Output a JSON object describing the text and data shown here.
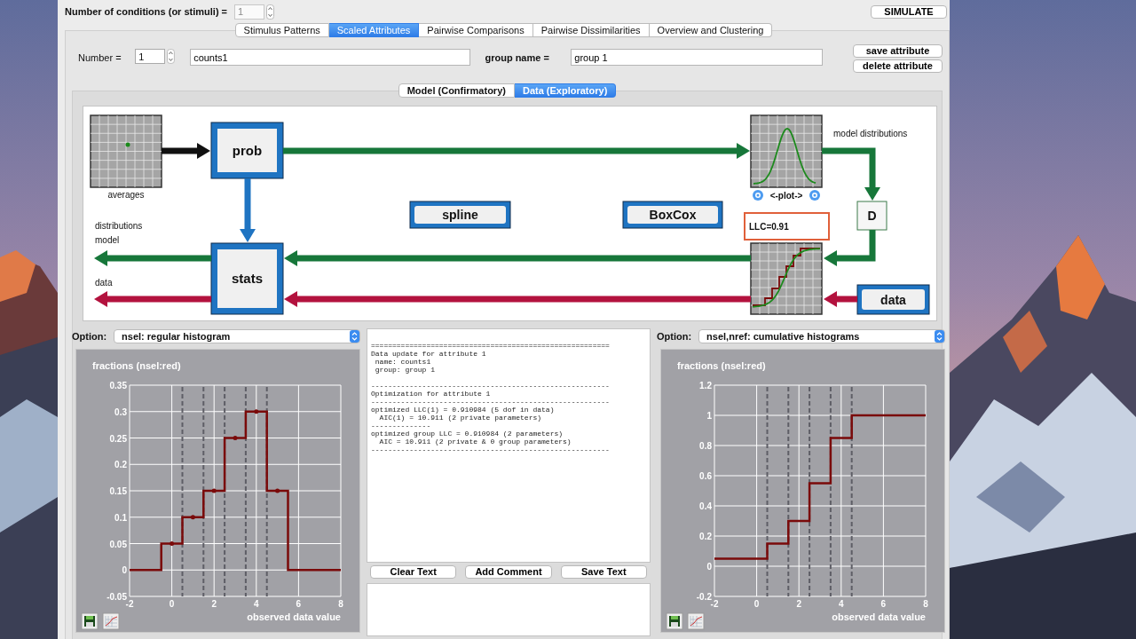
{
  "header": {
    "conditions_label": "Number of conditions (or stimuli) =",
    "conditions_value": "1",
    "simulate_button": "SIMULATE"
  },
  "tabs": [
    {
      "label": "Stimulus Patterns",
      "selected": false
    },
    {
      "label": "Scaled Attributes",
      "selected": true
    },
    {
      "label": "Pairwise Comparisons",
      "selected": false
    },
    {
      "label": "Pairwise Dissimilarities",
      "selected": false
    },
    {
      "label": "Overview and Clustering",
      "selected": false
    }
  ],
  "attribute": {
    "number_label": "Number =",
    "number_value": "1",
    "name_value": "counts1",
    "group_label": "group name =",
    "group_value": "group 1",
    "buttons": [
      "save attribute",
      "delete attribute"
    ]
  },
  "subtabs": [
    {
      "label": "Model (Confirmatory)",
      "selected": false
    },
    {
      "label": "Data (Exploratory)",
      "selected": true
    }
  ],
  "diagram": {
    "averages_label": "averages",
    "prob": "prob",
    "stats": "stats",
    "spline": "spline",
    "boxcox": "BoxCox",
    "plot_toggle": "<-plot->",
    "model_distributions": "model distributions",
    "d": "D",
    "llc": "LLC=0.91",
    "data_button": "data",
    "left_labels": [
      "distributions",
      "model",
      "data"
    ]
  },
  "left_panel": {
    "option_label": "Option:",
    "option_value": "nsel: regular histogram",
    "chart_data": {
      "type": "line",
      "title": "fractions (nsel:red)",
      "xlabel": "observed data value",
      "x": [
        -2,
        -0.5,
        -0.5,
        0,
        0.5,
        0.5,
        1,
        1.5,
        1.5,
        2,
        2.5,
        2.5,
        3,
        3.5,
        3.5,
        4,
        4.5,
        4.5,
        5,
        5.5,
        5.5,
        8
      ],
      "series": [
        {
          "color": "#7a0a0a",
          "values": [
            0,
            0,
            0.05,
            0.05,
            0.05,
            0.1,
            0.1,
            0.1,
            0.15,
            0.15,
            0.15,
            0.25,
            0.25,
            0.25,
            0.3,
            0.3,
            0.3,
            0.15,
            0.15,
            0.15,
            0,
            0
          ]
        }
      ],
      "xlim": [
        -2,
        8
      ],
      "ylim": [
        -0.05,
        0.35
      ],
      "xticks": [
        -2,
        0,
        2,
        4,
        6,
        8
      ],
      "yticks": [
        -0.05,
        0,
        0.05,
        0.1,
        0.15,
        0.2,
        0.25,
        0.3,
        0.35
      ],
      "grid": true,
      "ref_lines": [
        {
          "axis": "x",
          "value": 0.5
        },
        {
          "axis": "x",
          "value": 1.5
        },
        {
          "axis": "x",
          "value": 2.5
        },
        {
          "axis": "x",
          "value": 3.5
        },
        {
          "axis": "x",
          "value": 4.5
        }
      ]
    }
  },
  "log": {
    "text": "========================================================\nData update for attribute 1\n name: counts1\n group: group 1\n\n--------------------------------------------------------\nOptimization for attribute 1\n--------------------------------------------------------\noptimized LLC(1) = 0.910984 (5 dof in data)\n  AIC(1) = 10.911 (2 private parameters)\n--------------\noptimized group LLC = 0.910984 (2 parameters)\n  AIC = 10.911 (2 private & 0 group parameters)\n--------------------------------------------------------",
    "buttons": [
      "Clear Text",
      "Add Comment",
      "Save Text"
    ]
  },
  "right_panel": {
    "option_label": "Option:",
    "option_value": "nsel,nref: cumulative histograms",
    "chart_data": {
      "type": "line",
      "title": "fractions (nsel:red)",
      "xlabel": "observed data value",
      "x": [
        -2,
        0.5,
        0.5,
        1.5,
        1.5,
        2.5,
        2.5,
        3.5,
        3.5,
        4.5,
        4.5,
        8
      ],
      "series": [
        {
          "color": "#7a0a0a",
          "values": [
            0.05,
            0.05,
            0.15,
            0.15,
            0.3,
            0.3,
            0.55,
            0.55,
            0.85,
            0.85,
            1,
            1
          ]
        }
      ],
      "xlim": [
        -2,
        8
      ],
      "ylim": [
        -0.2,
        1.2
      ],
      "xticks": [
        -2,
        0,
        2,
        4,
        6,
        8
      ],
      "yticks": [
        -0.2,
        0,
        0.2,
        0.4,
        0.6,
        0.8,
        1,
        1.2
      ],
      "grid": true,
      "ref_lines": [
        {
          "axis": "x",
          "value": 0.5
        },
        {
          "axis": "x",
          "value": 1.5
        },
        {
          "axis": "x",
          "value": 2.5
        },
        {
          "axis": "x",
          "value": 3.5
        },
        {
          "axis": "x",
          "value": 4.5
        }
      ]
    }
  }
}
